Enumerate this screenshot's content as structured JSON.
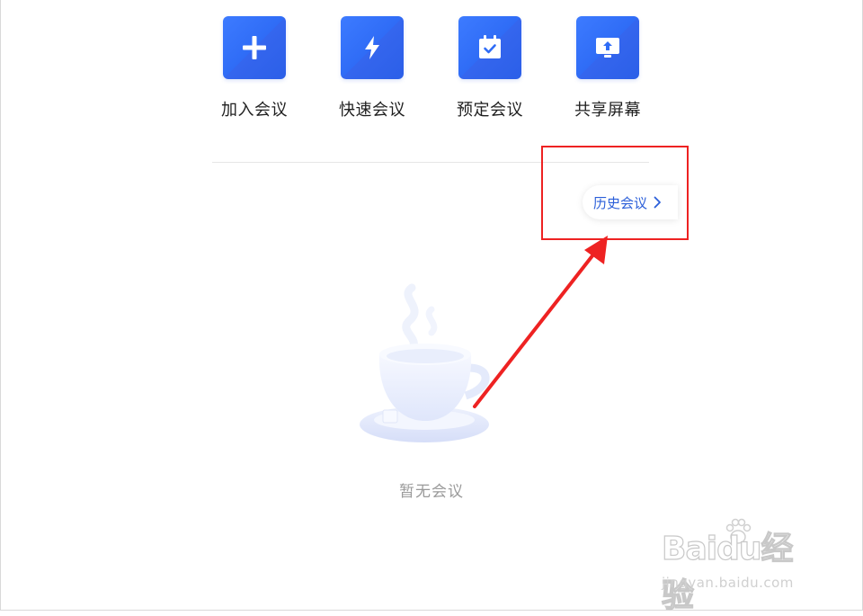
{
  "actions": [
    {
      "label": "加入会议",
      "icon": "plus-icon"
    },
    {
      "label": "快速会议",
      "icon": "lightning-icon"
    },
    {
      "label": "预定会议",
      "icon": "calendar-check-icon"
    },
    {
      "label": "共享屏幕",
      "icon": "screen-share-icon"
    }
  ],
  "history": {
    "label": "历史会议",
    "icon": "chevron-right-icon"
  },
  "empty_state": {
    "text": "暂无会议",
    "icon": "coffee-cup-icon"
  },
  "annotation": {
    "color": "#ee2222"
  },
  "watermark": {
    "main": "Baidu经验",
    "sub": "jingyan.baidu.com"
  },
  "colors": {
    "accent": "#2f6cf6",
    "history_text": "#2b5fd9",
    "empty_text": "#9a9a9a"
  }
}
